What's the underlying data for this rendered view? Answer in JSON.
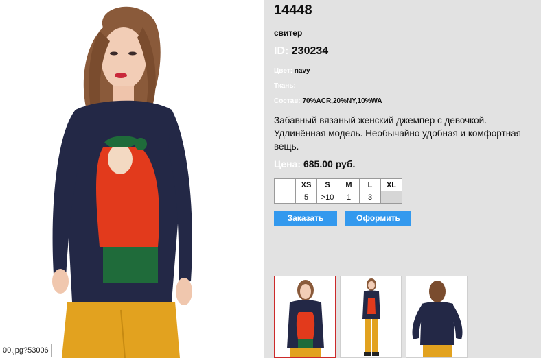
{
  "product": {
    "article": "14448",
    "name": "свитер",
    "id_label": "ID:",
    "id_value": "230234",
    "color_label": "Цвет:",
    "color_value": "navy",
    "fabric_label": "Ткань:",
    "fabric_value": "",
    "composition_label": "Состав:",
    "composition_value": "70%ACR,20%NY,10%WA",
    "description": "Забавный вязаный женский джемпер с девочкой. Удлинённая модель. Необычайно удобная и комфортная вещь.",
    "price_label": "Цена:",
    "price_value": "685.00 руб."
  },
  "sizes": {
    "headers": [
      "",
      "XS",
      "S",
      "M",
      "L",
      "XL"
    ],
    "stock": [
      "",
      "5",
      ">10",
      "1",
      "3",
      ""
    ]
  },
  "buttons": {
    "order_label": "Заказать",
    "checkout_label": "Оформить"
  },
  "status_tip": "00.jpg?53006",
  "colors": {
    "panel_bg": "#e2e2e2",
    "button_bg": "#3399ee",
    "sweater": "#232846",
    "trousers": "#e2a21f",
    "hair_red": "#e23a1c"
  },
  "thumbnails": [
    {
      "active": true,
      "view": "front-close"
    },
    {
      "active": false,
      "view": "front-full"
    },
    {
      "active": false,
      "view": "back"
    }
  ]
}
